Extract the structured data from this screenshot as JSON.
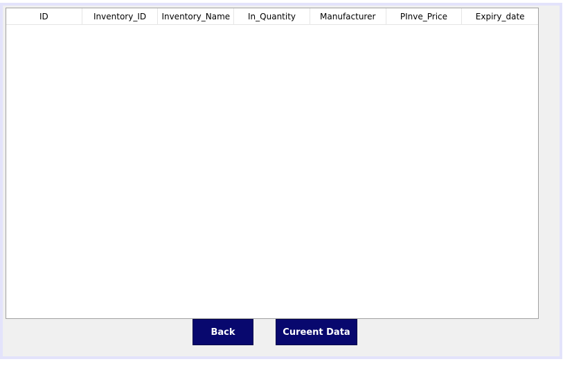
{
  "table": {
    "columns": [
      "ID",
      "Inventory_ID",
      "Inventory_Name",
      "In_Quantity",
      "Manufacturer",
      "PInve_Price",
      "Expiry_date"
    ],
    "rows": []
  },
  "buttons": {
    "back_label": "Back",
    "current_data_label": "Cureent Data"
  },
  "colors": {
    "button_bg": "#08086e",
    "frame_border": "#e3e3fb",
    "panel_bg": "#f0f0f0"
  }
}
